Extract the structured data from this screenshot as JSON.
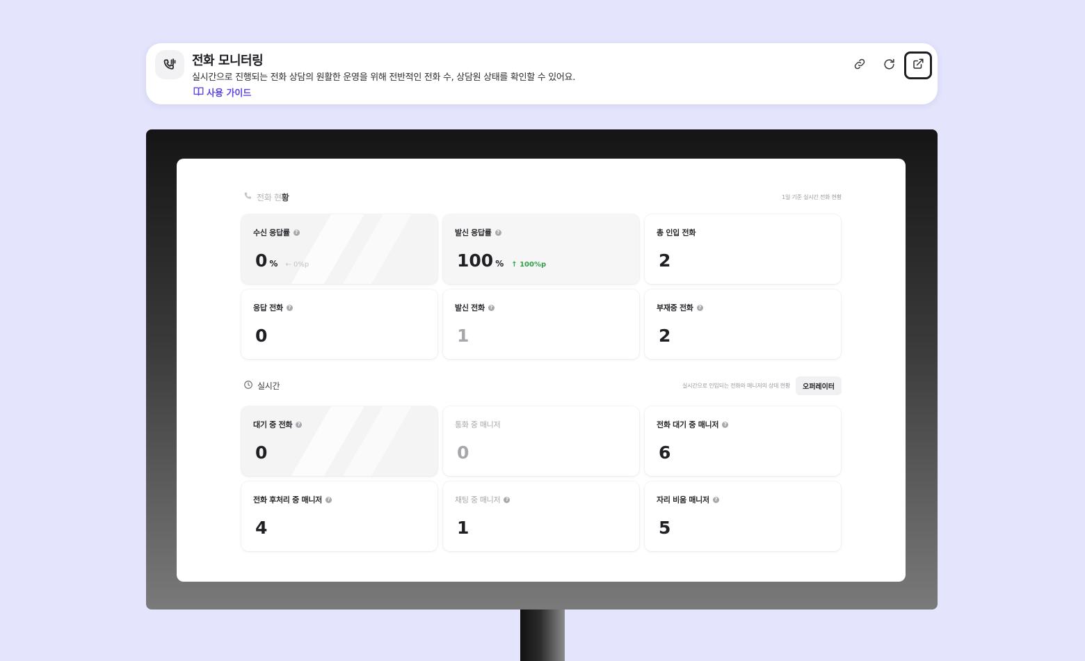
{
  "header": {
    "title": "전화 모니터링",
    "description": "실시간으로 진행되는 전화 상담의 원활한 운영을 위해 전반적인 전화 수, 상담원 상태를 확인할 수 있어요.",
    "guide_label": "사용 가이드",
    "icon": "phone-voice-icon",
    "actions": [
      "link-icon",
      "refresh-icon",
      "external-link-icon"
    ]
  },
  "call_status": {
    "title_faded": "전화 현",
    "title_strong": "황",
    "note": "1일 기준 실시간 전화 현황",
    "cards": [
      {
        "label": "수신 응답률",
        "value": "0",
        "unit": "%",
        "delta": "← 0%p"
      },
      {
        "label": "발신 응답률",
        "value": "100",
        "unit": "%",
        "delta": "↑ 100%p"
      },
      {
        "label": "총 인입 전화",
        "value": "2"
      },
      {
        "label": "응답 전화",
        "value": "0"
      },
      {
        "label": "발신 전화",
        "value": "1"
      },
      {
        "label": "부재중 전화",
        "value": "2"
      }
    ]
  },
  "realtime": {
    "title": "실시간",
    "note": "실시간으로 인입되는 전화와 매니저의 상태 현황",
    "operator_button": "오퍼레이터",
    "cards": [
      {
        "label": "대기 중 전화",
        "value": "0"
      },
      {
        "label": "통화 중 매니저",
        "value": "0"
      },
      {
        "label": "전화 대기 중 매니저",
        "value": "6"
      },
      {
        "label": "전화 후처리 중 매니저",
        "value": "4"
      },
      {
        "label": "채팅 중 매니저",
        "value": "1"
      },
      {
        "label": "자리 비움 매니저",
        "value": "5"
      }
    ]
  },
  "colors": {
    "background": "#e4e4fd",
    "accent": "#5b47e0",
    "positive": "#2f9f4a"
  }
}
